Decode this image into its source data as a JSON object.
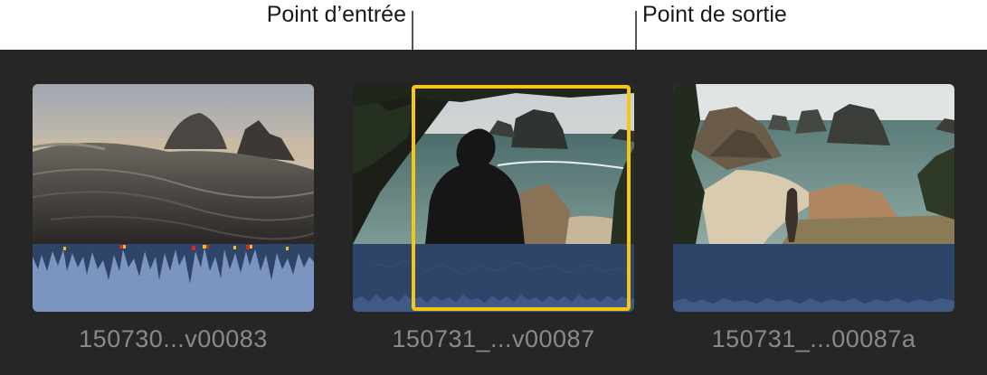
{
  "callouts": {
    "in_point": "Point d’entrée",
    "out_point": "Point de sortie"
  },
  "clips": [
    {
      "name": "150730...v00083",
      "thumbnail": "rocky-beach-driftwood-sunset",
      "waveform_color": "#7c94c0",
      "peak_colors": [
        "#d42a2a",
        "#f0c020"
      ]
    },
    {
      "name": "150731_...v00087",
      "thumbnail": "man-silhouette-sea-stacks",
      "waveform_color": "#3e5a85",
      "selected": true
    },
    {
      "name": "150731_...00087a",
      "thumbnail": "beach-cove-sea-stacks-person",
      "waveform_color": "#3e5a85"
    }
  ],
  "colors": {
    "range_selection": "#f5c518",
    "browser_background": "#262626",
    "audio_background": "#2e4468"
  }
}
